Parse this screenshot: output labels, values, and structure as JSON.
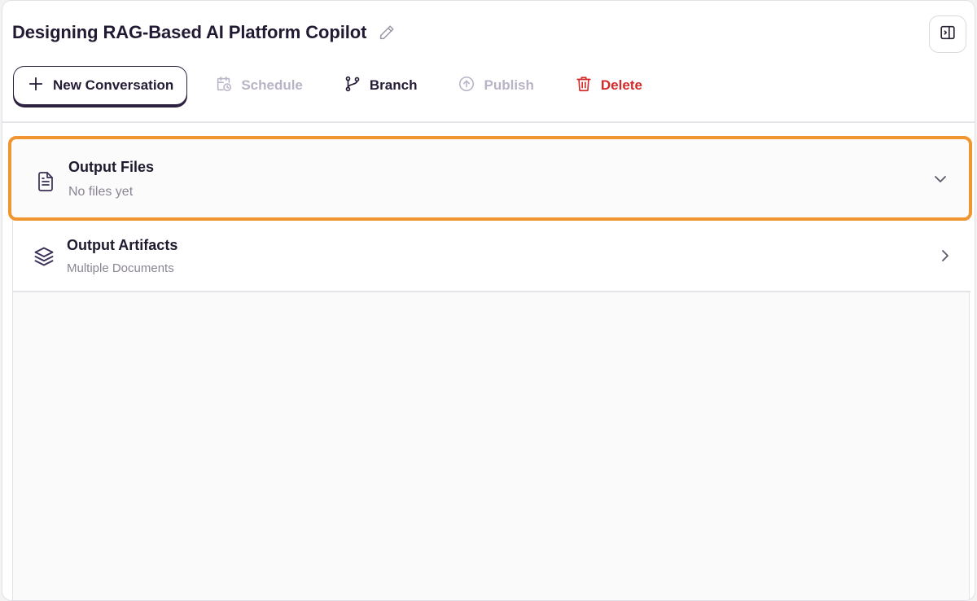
{
  "header": {
    "title": "Designing RAG-Based AI Platform Copilot"
  },
  "toolbar": {
    "new_conversation_label": "New Conversation",
    "schedule_label": "Schedule",
    "branch_label": "Branch",
    "publish_label": "Publish",
    "delete_label": "Delete"
  },
  "sections": [
    {
      "title": "Output Files",
      "subtitle": "No files yet",
      "icon": "file-text-icon",
      "state": "expanded"
    },
    {
      "title": "Output Artifacts",
      "subtitle": "Multiple Documents",
      "icon": "layers-icon",
      "state": "collapsed"
    }
  ],
  "colors": {
    "accent_highlight": "#f0952f",
    "primary_text": "#241b35",
    "disabled_text": "#b9b3c6",
    "danger": "#d42a2a"
  }
}
